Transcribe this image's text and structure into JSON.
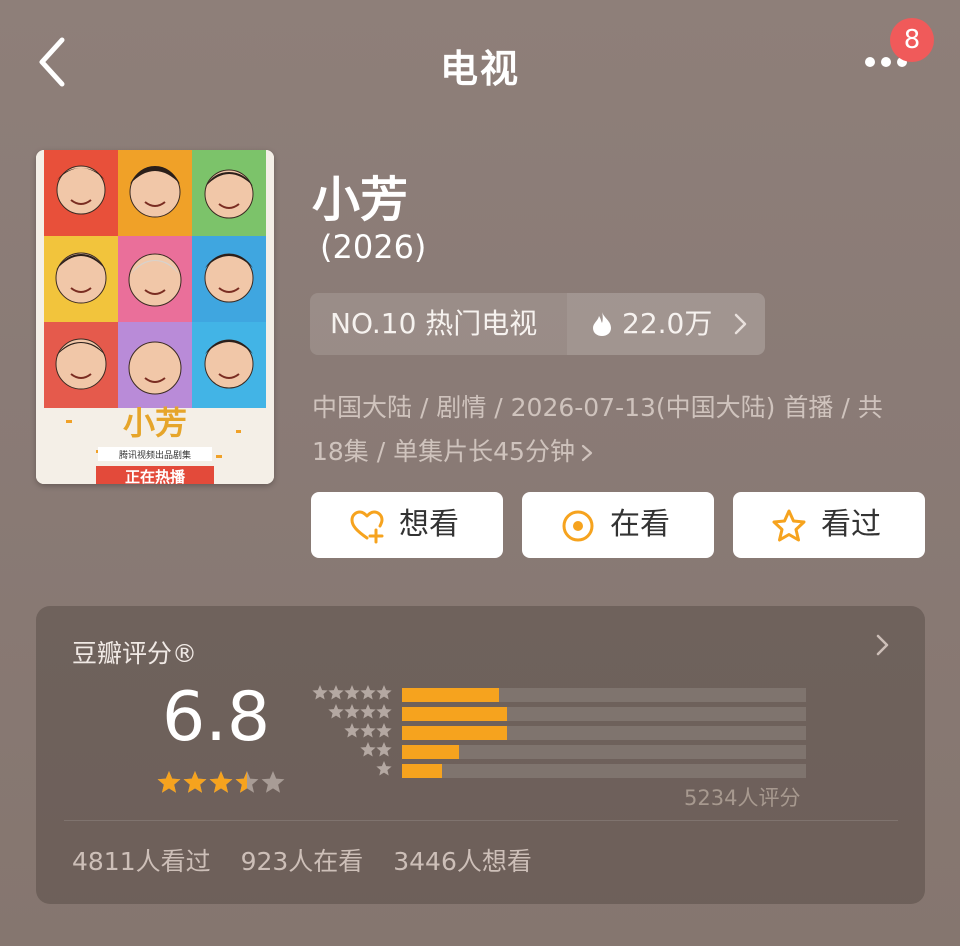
{
  "header": {
    "title": "电视",
    "badge_count": "8"
  },
  "show": {
    "title": "小芳",
    "year": "(2026)",
    "rank_label": "NO.10 热门电视",
    "heat": "22.0万",
    "info_line1": "中国大陆 / 剧情 / 2026-07-13(中国大陆) 首播 / 共",
    "info_line2": "18集 / 单集片长45分钟",
    "poster_text": {
      "title": "小芳",
      "subtitle": "腾讯视频出品剧集",
      "banner": "正在热播"
    }
  },
  "actions": [
    {
      "label": "想看",
      "icon": "heart-plus-icon"
    },
    {
      "label": "在看",
      "icon": "target-circle-icon"
    },
    {
      "label": "看过",
      "icon": "star-outline-icon"
    }
  ],
  "rating": {
    "title": "豆瓣评分®",
    "score": "6.8",
    "stars": 3.5,
    "count": "5234人评分",
    "distribution": [
      {
        "stars": 5,
        "fraction": 0.24
      },
      {
        "stars": 4,
        "fraction": 0.26
      },
      {
        "stars": 3,
        "fraction": 0.26
      },
      {
        "stars": 2,
        "fraction": 0.14
      },
      {
        "stars": 1,
        "fraction": 0.1
      }
    ],
    "stats": {
      "watched": "4811人看过",
      "watching": "923人在看",
      "want": "3446人想看"
    }
  },
  "colors": {
    "accent": "#f6a31e",
    "badge": "#f05a5a"
  }
}
